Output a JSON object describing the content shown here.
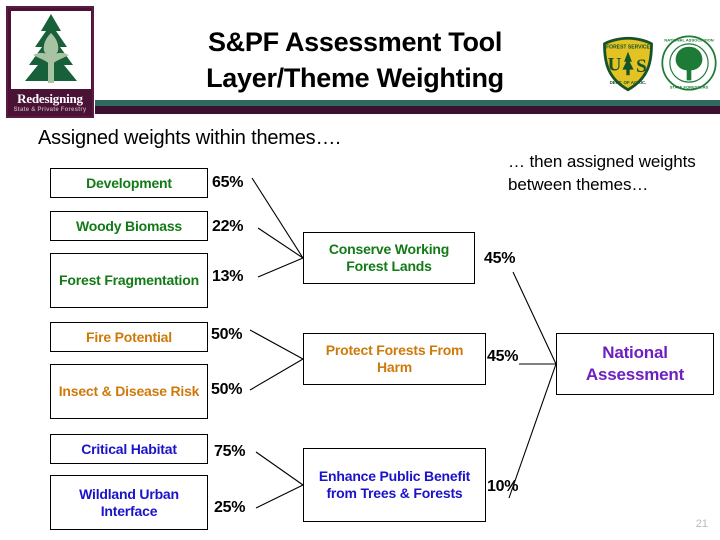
{
  "header": {
    "title_line1": "S&PF Assessment Tool",
    "title_line2": "Layer/Theme Weighting",
    "logo_word": "Redesigning",
    "logo_sub": "State & Private Forestry",
    "forest_service_logo": "us-forest-service-shield-icon",
    "circle_logo": "tree-circle-emblem-icon"
  },
  "body": {
    "lead_left": "Assigned weights within themes….",
    "lead_right": "…  then assigned weights between themes…"
  },
  "layers": [
    {
      "label": "Development",
      "weight": "65%",
      "color": "#127a16",
      "theme": "conserve"
    },
    {
      "label": "Woody Biomass",
      "weight": "22%",
      "color": "#127a16",
      "theme": "conserve"
    },
    {
      "label": "Forest Fragmentation",
      "weight": "13%",
      "color": "#127a16",
      "theme": "conserve"
    },
    {
      "label": "Fire Potential",
      "weight": "50%",
      "color": "#cd7a0b",
      "theme": "protect"
    },
    {
      "label": "Insect & Disease Risk",
      "weight": "50%",
      "color": "#cd7a0b",
      "theme": "protect"
    },
    {
      "label": "Critical Habitat",
      "weight": "75%",
      "color": "#1a13c9",
      "theme": "enhance"
    },
    {
      "label": "Wildland Urban Interface",
      "weight": "25%",
      "color": "#1a13c9",
      "theme": "enhance"
    }
  ],
  "themes": [
    {
      "label": "Conserve Working Forest Lands",
      "weight": "45%",
      "color": "#127a16"
    },
    {
      "label": "Protect Forests From Harm",
      "weight": "45%",
      "color": "#cd7a0b"
    },
    {
      "label": "Enhance Public Benefit from Trees & Forests",
      "weight": "10%",
      "color": "#1a13c9"
    }
  ],
  "result": {
    "label": "National Assessment",
    "color": "#6d1fbf"
  },
  "footer": {
    "slide_number": "21"
  }
}
